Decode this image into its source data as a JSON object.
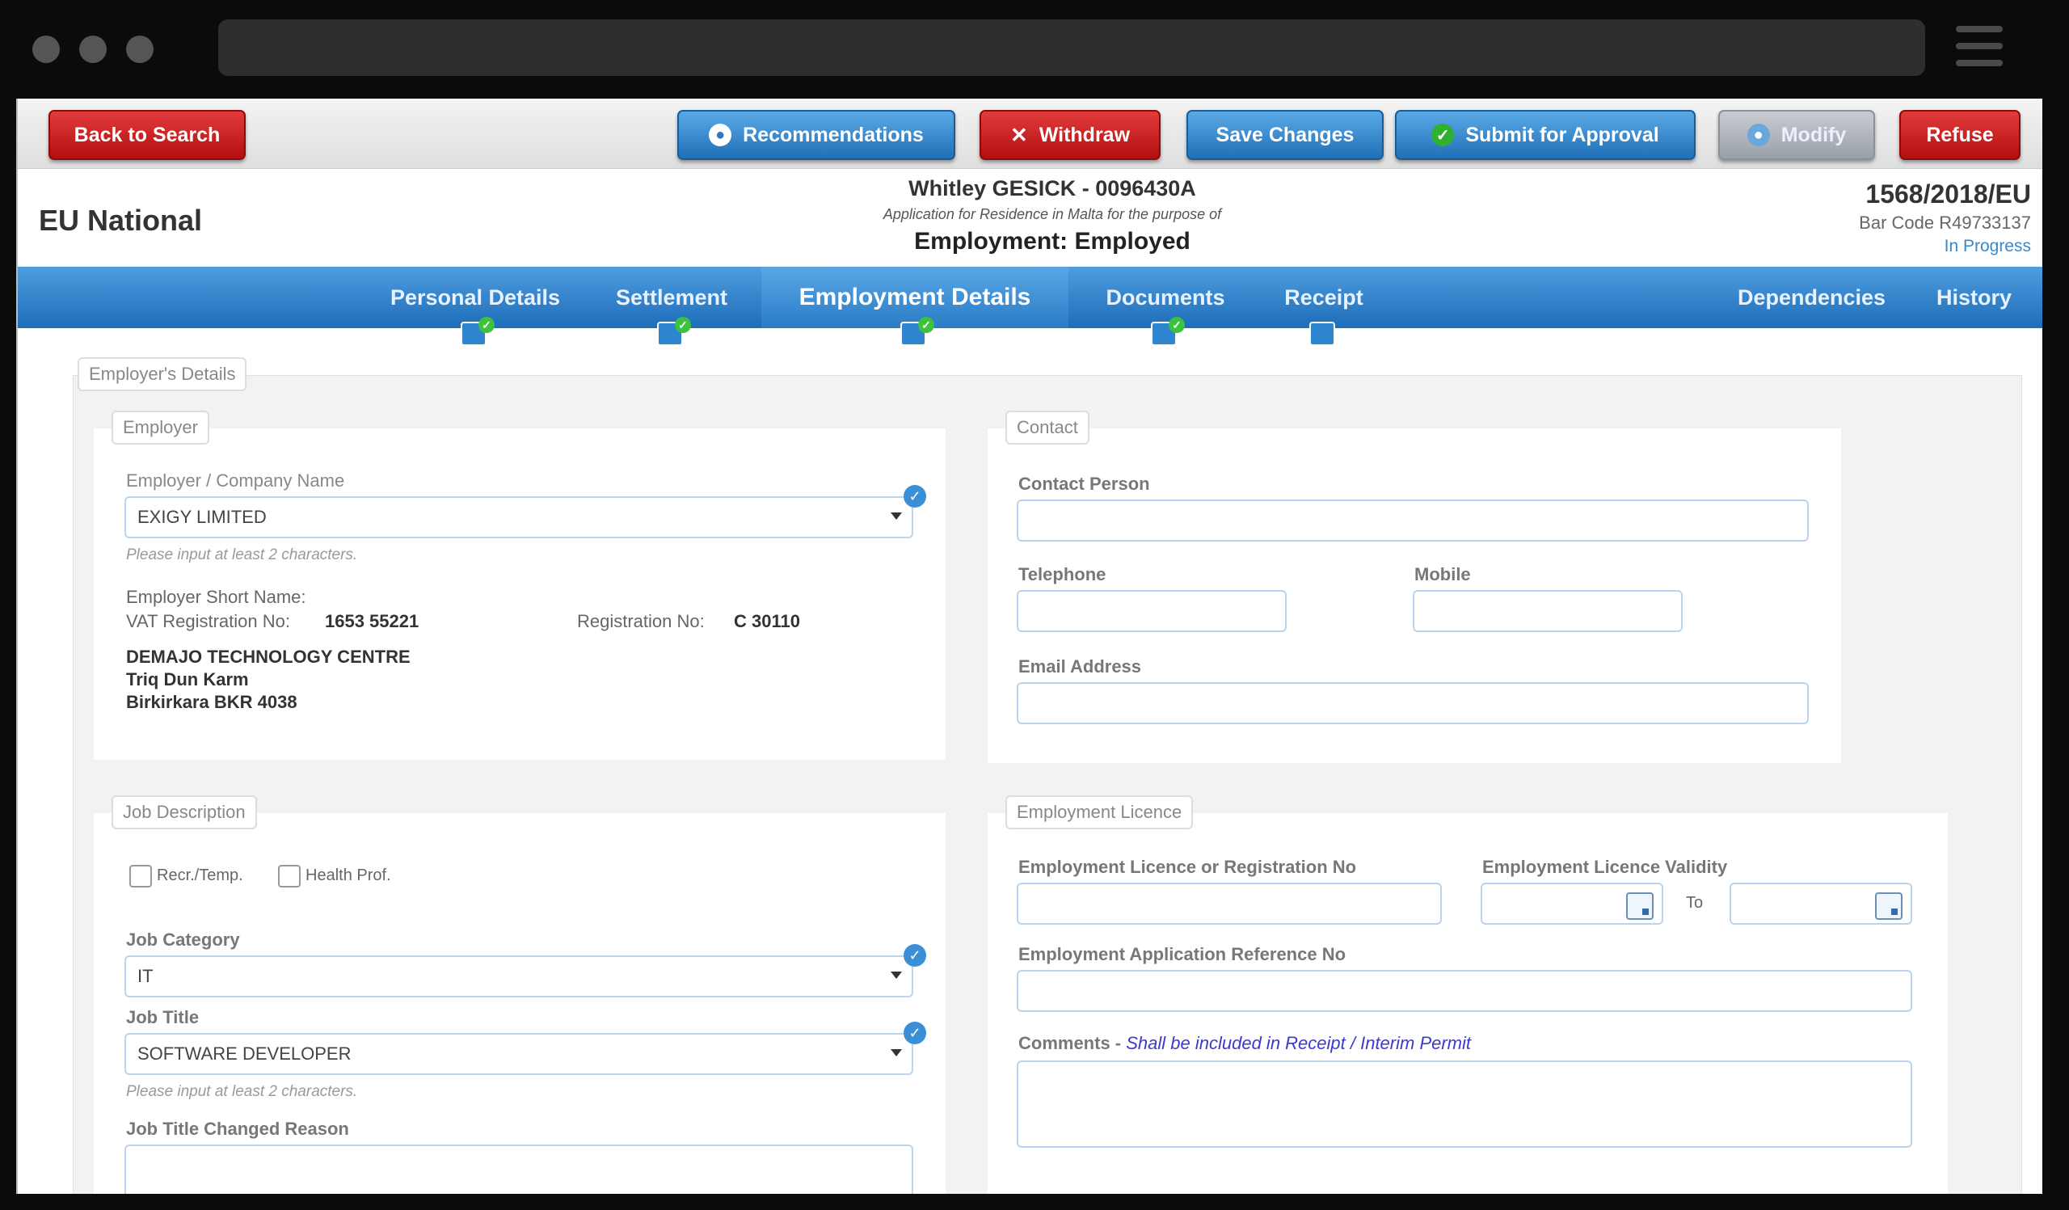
{
  "toolbar": {
    "back_to_search": "Back to Search",
    "recommendations": "Recommendations",
    "withdraw": "Withdraw",
    "save_changes": "Save Changes",
    "submit_for_approval": "Submit for Approval",
    "modify": "Modify",
    "refuse": "Refuse"
  },
  "header": {
    "type": "EU National",
    "applicant": "Whitley GESICK - 0096430A",
    "purpose_line": "Application for Residence in Malta for the purpose of",
    "purpose": "Employment: Employed",
    "case_no": "1568/2018/EU",
    "barcode": "Bar Code R49733137",
    "status": "In Progress"
  },
  "tabs": [
    {
      "label": "Personal Details"
    },
    {
      "label": "Settlement"
    },
    {
      "label": "Employment Details"
    },
    {
      "label": "Documents"
    },
    {
      "label": "Receipt"
    }
  ],
  "tabs_right": {
    "dependencies": "Dependencies",
    "history": "History"
  },
  "section": {
    "title": "Employer's Details"
  },
  "employer": {
    "legend": "Employer",
    "company_label": "Employer / Company Name",
    "company_value": "EXIGY LIMITED",
    "company_hint": "Please input at least 2 characters.",
    "short_name_label": "Employer Short Name:",
    "vat_label": "VAT Registration No:",
    "vat_value": "1653 55221",
    "reg_label": "Registration No:",
    "reg_value": "C 30110",
    "address_1": "DEMAJO TECHNOLOGY CENTRE",
    "address_2": "Triq Dun Karm",
    "address_3": "Birkirkara BKR 4038"
  },
  "contact": {
    "legend": "Contact",
    "person_label": "Contact Person",
    "person_value": "",
    "telephone_label": "Telephone",
    "telephone_value": "",
    "mobile_label": "Mobile",
    "mobile_value": "",
    "email_label": "Email Address",
    "email_value": ""
  },
  "job": {
    "legend": "Job Description",
    "recr_temp": "Recr./Temp.",
    "health_prof": "Health Prof.",
    "category_label": "Job Category",
    "category_value": "IT",
    "title_label": "Job Title",
    "title_value": "SOFTWARE DEVELOPER",
    "title_hint": "Please input at least 2 characters.",
    "changed_reason_label": "Job Title Changed Reason",
    "changed_reason_value": ""
  },
  "licence": {
    "legend": "Employment Licence",
    "licence_no_label": "Employment Licence or Registration No",
    "licence_no_value": "",
    "validity_label": "Employment Licence Validity",
    "from_value": "",
    "to_label": "To",
    "to_value": "",
    "app_ref_label": "Employment Application Reference No",
    "app_ref_value": "",
    "comments_label": "Comments -",
    "comments_note": "Shall be included in Receipt / Interim Permit",
    "comments_value": ""
  },
  "colors": {
    "danger": "#c21b1b",
    "primary": "#2f86d0",
    "tabbar": "#2a7cc6",
    "success": "#3cc23c"
  }
}
